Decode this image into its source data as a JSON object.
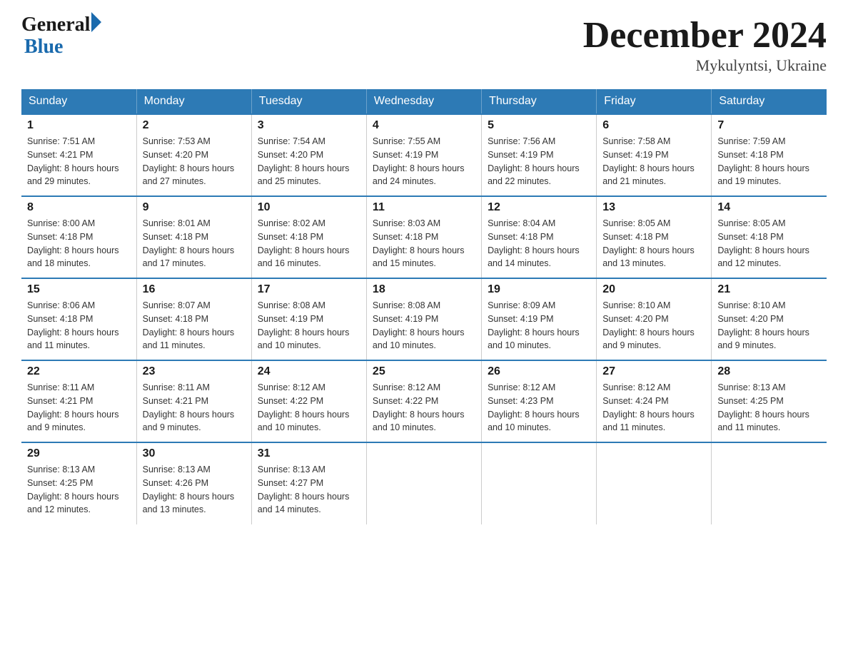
{
  "header": {
    "logo": {
      "general": "General",
      "blue": "Blue"
    },
    "title": "December 2024",
    "subtitle": "Mykulyntsi, Ukraine"
  },
  "days_of_week": [
    "Sunday",
    "Monday",
    "Tuesday",
    "Wednesday",
    "Thursday",
    "Friday",
    "Saturday"
  ],
  "weeks": [
    [
      {
        "day": "1",
        "sunrise": "7:51 AM",
        "sunset": "4:21 PM",
        "daylight": "8 hours and 29 minutes."
      },
      {
        "day": "2",
        "sunrise": "7:53 AM",
        "sunset": "4:20 PM",
        "daylight": "8 hours and 27 minutes."
      },
      {
        "day": "3",
        "sunrise": "7:54 AM",
        "sunset": "4:20 PM",
        "daylight": "8 hours and 25 minutes."
      },
      {
        "day": "4",
        "sunrise": "7:55 AM",
        "sunset": "4:19 PM",
        "daylight": "8 hours and 24 minutes."
      },
      {
        "day": "5",
        "sunrise": "7:56 AM",
        "sunset": "4:19 PM",
        "daylight": "8 hours and 22 minutes."
      },
      {
        "day": "6",
        "sunrise": "7:58 AM",
        "sunset": "4:19 PM",
        "daylight": "8 hours and 21 minutes."
      },
      {
        "day": "7",
        "sunrise": "7:59 AM",
        "sunset": "4:18 PM",
        "daylight": "8 hours and 19 minutes."
      }
    ],
    [
      {
        "day": "8",
        "sunrise": "8:00 AM",
        "sunset": "4:18 PM",
        "daylight": "8 hours and 18 minutes."
      },
      {
        "day": "9",
        "sunrise": "8:01 AM",
        "sunset": "4:18 PM",
        "daylight": "8 hours and 17 minutes."
      },
      {
        "day": "10",
        "sunrise": "8:02 AM",
        "sunset": "4:18 PM",
        "daylight": "8 hours and 16 minutes."
      },
      {
        "day": "11",
        "sunrise": "8:03 AM",
        "sunset": "4:18 PM",
        "daylight": "8 hours and 15 minutes."
      },
      {
        "day": "12",
        "sunrise": "8:04 AM",
        "sunset": "4:18 PM",
        "daylight": "8 hours and 14 minutes."
      },
      {
        "day": "13",
        "sunrise": "8:05 AM",
        "sunset": "4:18 PM",
        "daylight": "8 hours and 13 minutes."
      },
      {
        "day": "14",
        "sunrise": "8:05 AM",
        "sunset": "4:18 PM",
        "daylight": "8 hours and 12 minutes."
      }
    ],
    [
      {
        "day": "15",
        "sunrise": "8:06 AM",
        "sunset": "4:18 PM",
        "daylight": "8 hours and 11 minutes."
      },
      {
        "day": "16",
        "sunrise": "8:07 AM",
        "sunset": "4:18 PM",
        "daylight": "8 hours and 11 minutes."
      },
      {
        "day": "17",
        "sunrise": "8:08 AM",
        "sunset": "4:19 PM",
        "daylight": "8 hours and 10 minutes."
      },
      {
        "day": "18",
        "sunrise": "8:08 AM",
        "sunset": "4:19 PM",
        "daylight": "8 hours and 10 minutes."
      },
      {
        "day": "19",
        "sunrise": "8:09 AM",
        "sunset": "4:19 PM",
        "daylight": "8 hours and 10 minutes."
      },
      {
        "day": "20",
        "sunrise": "8:10 AM",
        "sunset": "4:20 PM",
        "daylight": "8 hours and 9 minutes."
      },
      {
        "day": "21",
        "sunrise": "8:10 AM",
        "sunset": "4:20 PM",
        "daylight": "8 hours and 9 minutes."
      }
    ],
    [
      {
        "day": "22",
        "sunrise": "8:11 AM",
        "sunset": "4:21 PM",
        "daylight": "8 hours and 9 minutes."
      },
      {
        "day": "23",
        "sunrise": "8:11 AM",
        "sunset": "4:21 PM",
        "daylight": "8 hours and 9 minutes."
      },
      {
        "day": "24",
        "sunrise": "8:12 AM",
        "sunset": "4:22 PM",
        "daylight": "8 hours and 10 minutes."
      },
      {
        "day": "25",
        "sunrise": "8:12 AM",
        "sunset": "4:22 PM",
        "daylight": "8 hours and 10 minutes."
      },
      {
        "day": "26",
        "sunrise": "8:12 AM",
        "sunset": "4:23 PM",
        "daylight": "8 hours and 10 minutes."
      },
      {
        "day": "27",
        "sunrise": "8:12 AM",
        "sunset": "4:24 PM",
        "daylight": "8 hours and 11 minutes."
      },
      {
        "day": "28",
        "sunrise": "8:13 AM",
        "sunset": "4:25 PM",
        "daylight": "8 hours and 11 minutes."
      }
    ],
    [
      {
        "day": "29",
        "sunrise": "8:13 AM",
        "sunset": "4:25 PM",
        "daylight": "8 hours and 12 minutes."
      },
      {
        "day": "30",
        "sunrise": "8:13 AM",
        "sunset": "4:26 PM",
        "daylight": "8 hours and 13 minutes."
      },
      {
        "day": "31",
        "sunrise": "8:13 AM",
        "sunset": "4:27 PM",
        "daylight": "8 hours and 14 minutes."
      },
      null,
      null,
      null,
      null
    ]
  ],
  "labels": {
    "sunrise": "Sunrise:",
    "sunset": "Sunset:",
    "daylight": "Daylight:"
  }
}
